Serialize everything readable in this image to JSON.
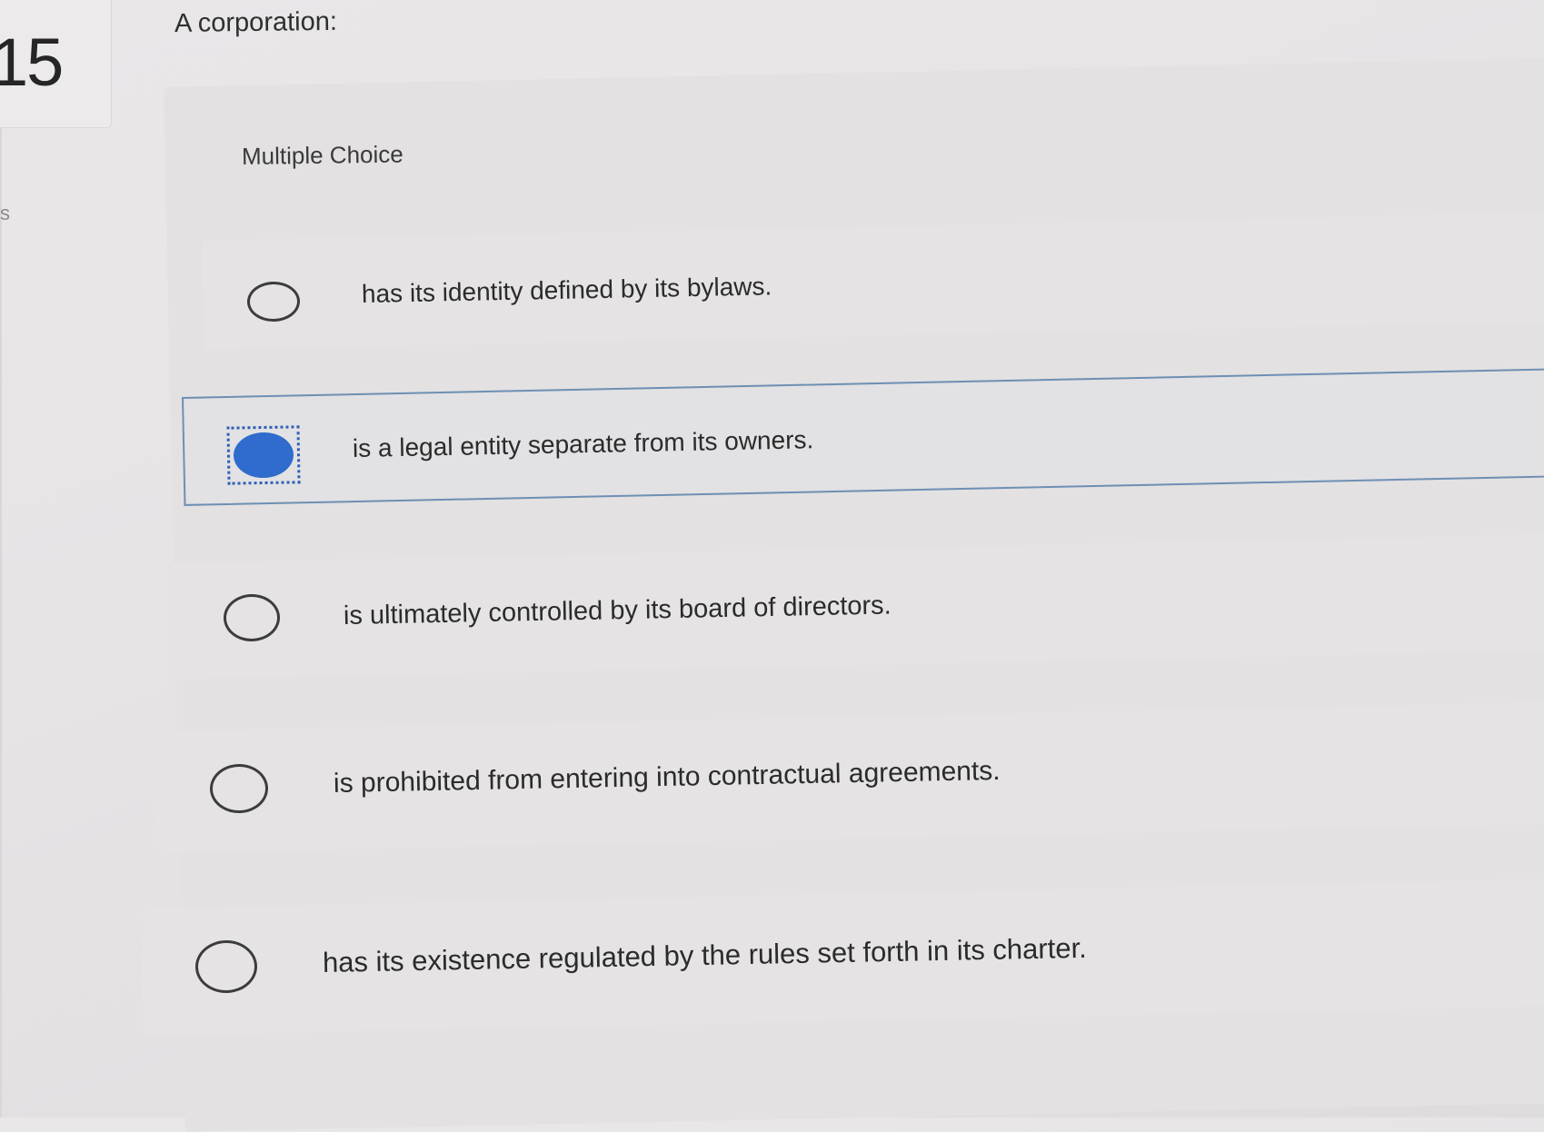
{
  "question": {
    "number": "15",
    "side_letter": "s",
    "prompt": "A corporation:",
    "type_label": "Multiple Choice"
  },
  "options": [
    {
      "text": "has its identity defined by its bylaws.",
      "selected": false
    },
    {
      "text": "is a legal entity separate from its owners.",
      "selected": true
    },
    {
      "text": "is ultimately controlled by its board of directors.",
      "selected": false
    },
    {
      "text": "is prohibited from entering into contractual agreements.",
      "selected": false
    },
    {
      "text": "has its existence regulated by the rules set forth in its charter.",
      "selected": false
    }
  ],
  "colors": {
    "selected_radio": "#2f6ccd",
    "selected_border": "#6e8fb3",
    "background": "#e8e6e7"
  }
}
